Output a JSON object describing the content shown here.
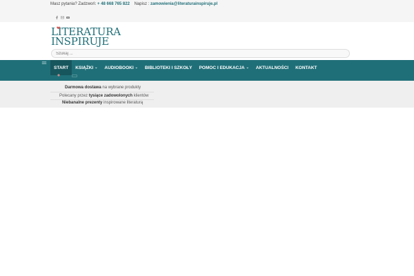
{
  "topbar": {
    "question": "Masz pytania? Zadzwoń:",
    "phone": "+ 48 668 765 822",
    "write_label": "Napisz :",
    "email": "zamowienia@literaturainspiruje.pl",
    "social_icons": [
      "facebook-icon",
      "mail-icon",
      "youtube-icon"
    ]
  },
  "logo": {
    "line1": "LITERATURA",
    "line2": "INSPIRUJE"
  },
  "search": {
    "placeholder": "Szukaj ..."
  },
  "nav": {
    "items": [
      {
        "label": "START",
        "dropdown": false,
        "active": true
      },
      {
        "label": "KSIĄŻKI",
        "dropdown": true
      },
      {
        "label": "AUDIOBOOKI",
        "dropdown": true
      },
      {
        "label": "BIBLIOTEKI I SZKOŁY",
        "dropdown": false
      },
      {
        "label": "POMOC I EDUKACJA",
        "dropdown": true
      },
      {
        "label": "AKTUALNOŚCI",
        "dropdown": false
      },
      {
        "label": "KONTAKT",
        "dropdown": false
      }
    ]
  },
  "usp": [
    {
      "bold": "Darmowa dostawa",
      "rest": " na wybrane produkty"
    },
    {
      "pre": "Polecany przez ",
      "bold": "tysiące zadowolonych",
      "rest": " klientów"
    },
    {
      "bold": "Niebanalne prezenty",
      "rest": " inspirowane literaturą"
    }
  ],
  "colors": {
    "accent": "#1f6f78",
    "nav_active": "#17565d",
    "topbar_bg": "#f5f5f5",
    "usp_bg": "#efefef"
  }
}
